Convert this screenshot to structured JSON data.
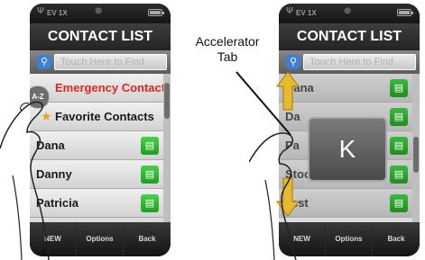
{
  "left_screen": {
    "status": {
      "signal": "Ψ",
      "network": "EV 1X",
      "gps": "⊕"
    },
    "title": "CONTACT LIST",
    "search_placeholder": "Touch Here to Find",
    "accelerator_tab": "A-Z",
    "rows": [
      {
        "label": "Emergency Contacts",
        "kind": "emergency"
      },
      {
        "label": "Favorite Contacts",
        "kind": "favorite",
        "icon": "star-icon"
      },
      {
        "label": "Dana",
        "kind": "contact"
      },
      {
        "label": "Danny",
        "kind": "contact"
      },
      {
        "label": "Patricia",
        "kind": "contact"
      }
    ],
    "softkeys": {
      "new": "NEW",
      "options": "Options",
      "back": "Back"
    }
  },
  "right_screen": {
    "status": {
      "signal": "Ψ",
      "network": "EV 1X",
      "gps": "⊕"
    },
    "title": "CONTACT LIST",
    "search_placeholder": "Touch Here to Find",
    "rows": [
      "Dana",
      "Da",
      "Pa",
      "Stoc",
      "Test"
    ],
    "popup_letter": "K",
    "softkeys": {
      "new": "NEW",
      "options": "Options",
      "back": "Back"
    }
  },
  "callout": {
    "line1": "Accelerator",
    "line2": "Tab"
  },
  "colors": {
    "emergency_text": "#e0261f",
    "contact_icon_green": "#2fb42f",
    "search_icon_blue": "#3d7fd0",
    "arrow_yellow": "#e8b92a"
  },
  "icons": [
    "search-icon",
    "star-icon",
    "contact-card-icon",
    "battery-icon",
    "signal-icon",
    "gps-icon",
    "up-arrow-icon",
    "down-arrow-icon"
  ]
}
